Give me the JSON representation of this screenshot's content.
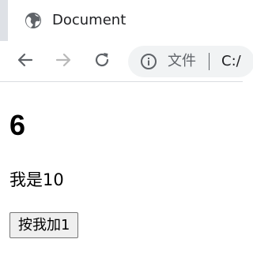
{
  "window": {
    "tab_title": "Document"
  },
  "toolbar": {
    "back_icon": "arrow-left-icon",
    "forward_icon": "arrow-right-icon",
    "reload_icon": "reload-icon",
    "address": {
      "info_icon": "info-icon",
      "label": "文件",
      "url": "C:/"
    }
  },
  "page": {
    "counter": "6",
    "text": "我是10",
    "button_label": "按我加1"
  },
  "colors": {
    "tab_bar": "#dee1e6",
    "omnibox": "#f1f3f4",
    "icon": "#5f6368",
    "icon_disabled": "#b9b9b9",
    "button_bg": "#efefef",
    "button_border": "#767676"
  }
}
